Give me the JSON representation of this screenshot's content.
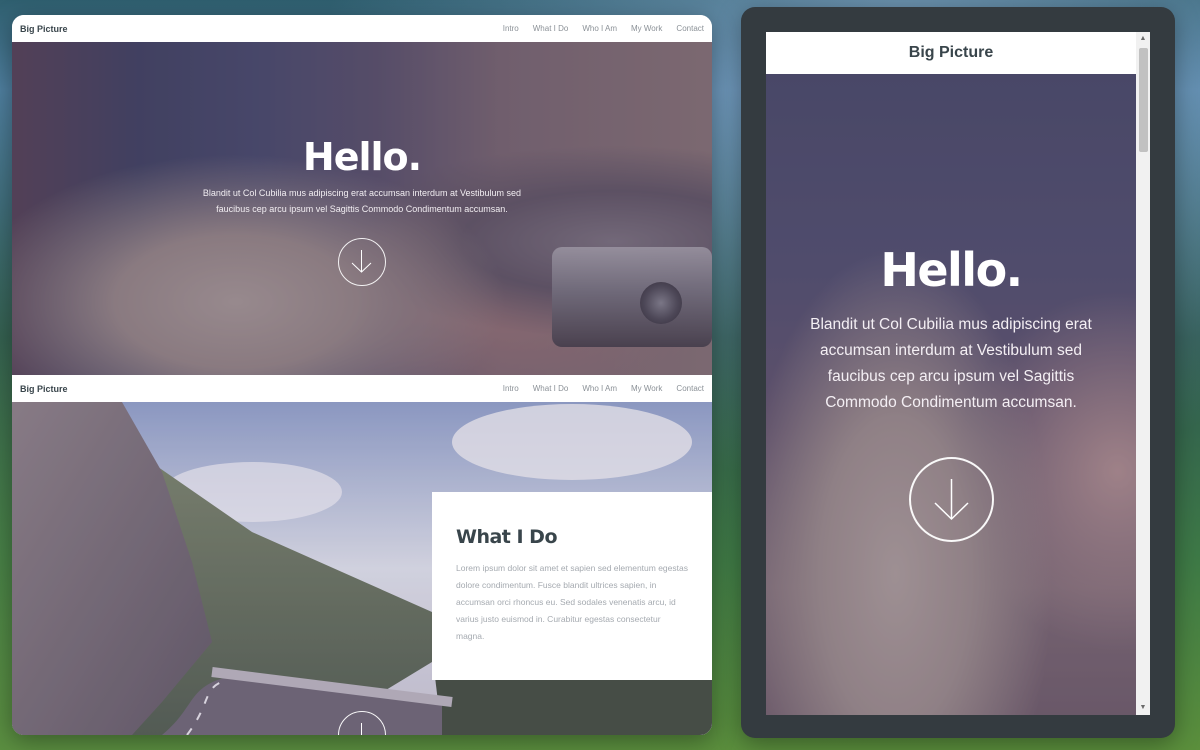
{
  "brand": "Big Picture",
  "nav": {
    "links": [
      "Intro",
      "What I Do",
      "Who I Am",
      "My Work",
      "Contact"
    ]
  },
  "intro": {
    "heading": "Hello.",
    "text": "Blandit ut Col Cubilia mus adipiscing erat accumsan interdum at Vestibulum sed faucibus cep arcu ipsum vel Sagittis Commodo Condimentum accumsan.",
    "scroll_icon": "arrow-down-circle-icon"
  },
  "work": {
    "heading": "What I Do",
    "text": "Lorem ipsum dolor sit amet et sapien sed elementum egestas dolore condimentum. Fusce blandit ultrices sapien, in accumsan orci rhoncus eu. Sed sodales venenatis arcu, id varius justo euismod in. Curabitur egestas consectetur magna.",
    "scroll_icon": "arrow-down-circle-icon"
  },
  "mobile": {
    "brand": "Big Picture",
    "heading": "Hello.",
    "text": "Blandit ut Col Cubilia mus adipiscing erat accumsan interdum at Vestibulum sed faucibus cep arcu ipsum vel Sagittis Commodo Condimentum accumsan.",
    "scroll_up_glyph": "▲",
    "scroll_down_glyph": "▼"
  },
  "colors": {
    "nav_text": "#8b9197",
    "heading_dark": "#39454b",
    "body_muted": "#a5aab0",
    "frame": "#343b40"
  }
}
